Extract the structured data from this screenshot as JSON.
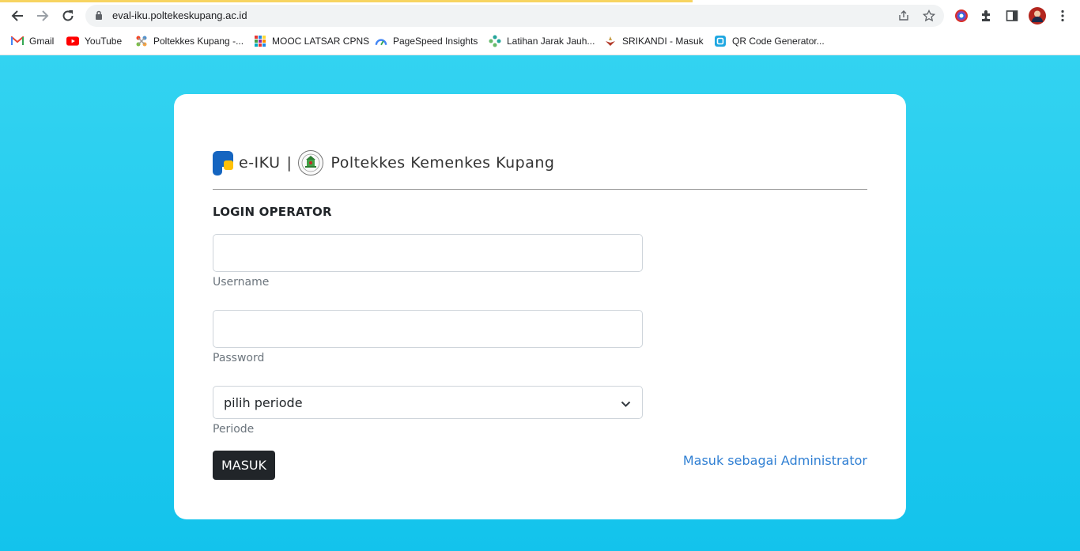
{
  "browser": {
    "url": "eval-iku.poltekeskupang.ac.id",
    "bookmarks": [
      {
        "label": "Gmail",
        "icon": "gmail-icon"
      },
      {
        "label": "YouTube",
        "icon": "youtube-icon"
      },
      {
        "label": "Poltekkes Kupang -...",
        "icon": "joomla-icon"
      },
      {
        "label": "MOOC LATSAR CPNS",
        "icon": "mooc-icon"
      },
      {
        "label": "PageSpeed Insights",
        "icon": "pagespeed-icon"
      },
      {
        "label": "Latihan Jarak Jauh...",
        "icon": "latihan-icon"
      },
      {
        "label": "SRIKANDI - Masuk",
        "icon": "srikandi-icon"
      },
      {
        "label": "QR Code Generator...",
        "icon": "qrcode-icon"
      }
    ]
  },
  "login": {
    "app_name": "e-IKU",
    "separator": "|",
    "institution": "Poltekkes Kemenkes Kupang",
    "heading": "LOGIN OPERATOR",
    "username": {
      "value": "",
      "label": "Username"
    },
    "password": {
      "value": "",
      "label": "Password"
    },
    "periode": {
      "selected": "pilih periode",
      "label": "Periode"
    },
    "submit_label": "MASUK",
    "admin_link": "Masuk sebagai Administrator"
  },
  "colors": {
    "background": "#13c3ec",
    "button": "#212529",
    "link": "#2f7fd3"
  }
}
